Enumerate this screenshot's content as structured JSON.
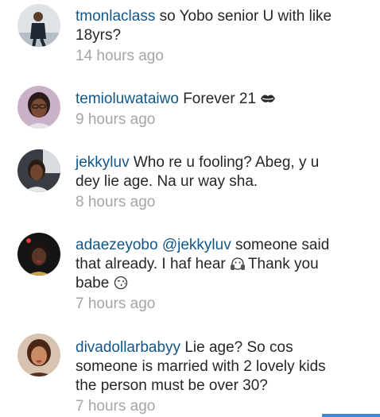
{
  "comments": [
    {
      "username": "tmonlaclass",
      "text": "so Yobo senior U with like 18yrs?",
      "time": "14 hours ago",
      "avatar": "avatar-man-suit"
    },
    {
      "username": "temioluwataiwo",
      "text": "Forever 21",
      "emoji_after": "kiss-lips-icon",
      "time": "9 hours ago",
      "avatar": "avatar-woman-glasses"
    },
    {
      "username": "jekkyluv",
      "text": "Who re u fooling? Abeg, y u dey lie age. Na ur way sha.",
      "time": "8 hours ago",
      "avatar": "avatar-woman-car"
    },
    {
      "username": "adaezeyobo",
      "mention": "@jekkyluv",
      "text_part1": "someone said that already. I haf hear",
      "emoji_mid": "face-with-hands-icon",
      "text_part2": "Thank you babe",
      "emoji_end": "kissing-face-icon",
      "time": "7 hours ago",
      "avatar": "avatar-woman-dark-bg"
    },
    {
      "username": "divadollarbabyy",
      "text": "Lie age? So cos someone is married with 2 lovely kids the person must be over 30?",
      "time": "7 hours ago",
      "avatar": "avatar-woman-selfie"
    }
  ],
  "colors": {
    "username": "#125688",
    "text": "#262626",
    "time": "#a5a5a5",
    "accent_bar": "#3f8ad8"
  }
}
